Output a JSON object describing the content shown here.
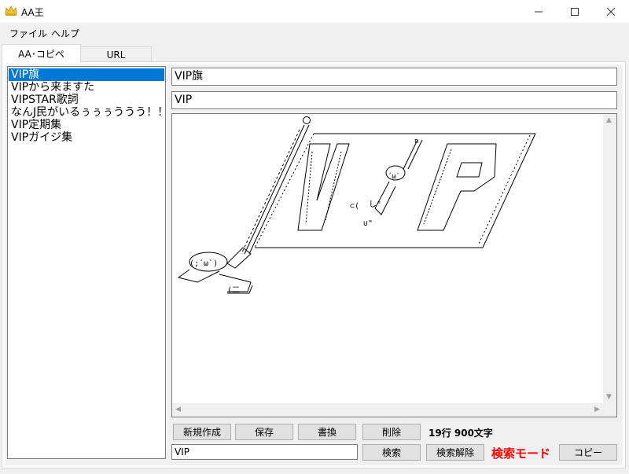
{
  "window": {
    "title": "AA王"
  },
  "menu": {
    "file": "ファイル",
    "help": "ヘルプ"
  },
  "tabs": [
    {
      "label": "AA･コピペ"
    },
    {
      "label": "URL"
    }
  ],
  "list": {
    "items": [
      {
        "label": "VIP旗"
      },
      {
        "label": "VIPから来ますた"
      },
      {
        "label": "VIPSTAR歌詞"
      },
      {
        "label": "なんJ民がいるぅぅぅううう！！"
      },
      {
        "label": "VIP定期集"
      },
      {
        "label": "VIPガイジ集"
      }
    ],
    "selected_index": 0
  },
  "editor": {
    "title_value": "VIP旗",
    "tag_value": "VIP"
  },
  "buttons": {
    "new": "新規作成",
    "save": "保存",
    "overwrite": "書換",
    "delete": "削除",
    "search": "検索",
    "clear_search": "検索解除",
    "copy": "コピー"
  },
  "status": {
    "stats": "19行 900文字",
    "mode": "検索モード",
    "mode_color": "#ff0000"
  },
  "search": {
    "value": "VIP"
  },
  "colors": {
    "selection": "#0078d7",
    "crown": "#f4c430"
  }
}
